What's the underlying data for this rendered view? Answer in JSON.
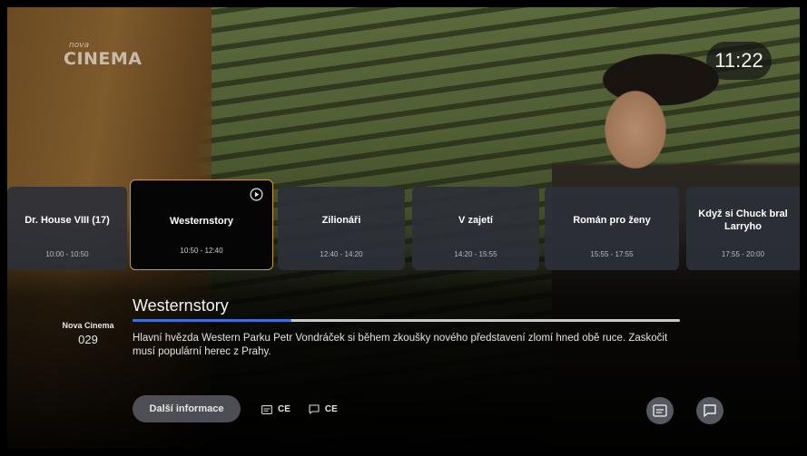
{
  "channel_logo": {
    "small": "nova",
    "big": "CINEMA"
  },
  "clock": "11:22",
  "epg": {
    "items": [
      {
        "title": "Dr. House VIII (17)",
        "time": "10:00 - 10:50"
      },
      {
        "title": "Westernstory",
        "time": "10:50 - 12:40",
        "active": true
      },
      {
        "title": "Zilionáři",
        "time": "12:40 - 14:20"
      },
      {
        "title": "V zajetí",
        "time": "14:20 - 15:55"
      },
      {
        "title": "Román pro ženy",
        "time": "15:55 - 17:55"
      },
      {
        "title": "Když si Chuck bral Larryho",
        "time": "17:55 - 20:00"
      }
    ]
  },
  "program": {
    "title": "Westernstory",
    "progress": 0.29,
    "description": "Hlavní hvězda Western Parku Petr Vondráček si během zkoušky nového představení zlomí hned obě ruce. Zaskočit musí populární herec z Prahy."
  },
  "channel": {
    "name": "Nova Cinema",
    "number": "029"
  },
  "actions": {
    "more_info": "Další informace",
    "audio_lang": "CE",
    "subtitle_lang": "CE"
  },
  "colors": {
    "accent_border": "#c99a3c",
    "progress": "#3d6fd6"
  }
}
